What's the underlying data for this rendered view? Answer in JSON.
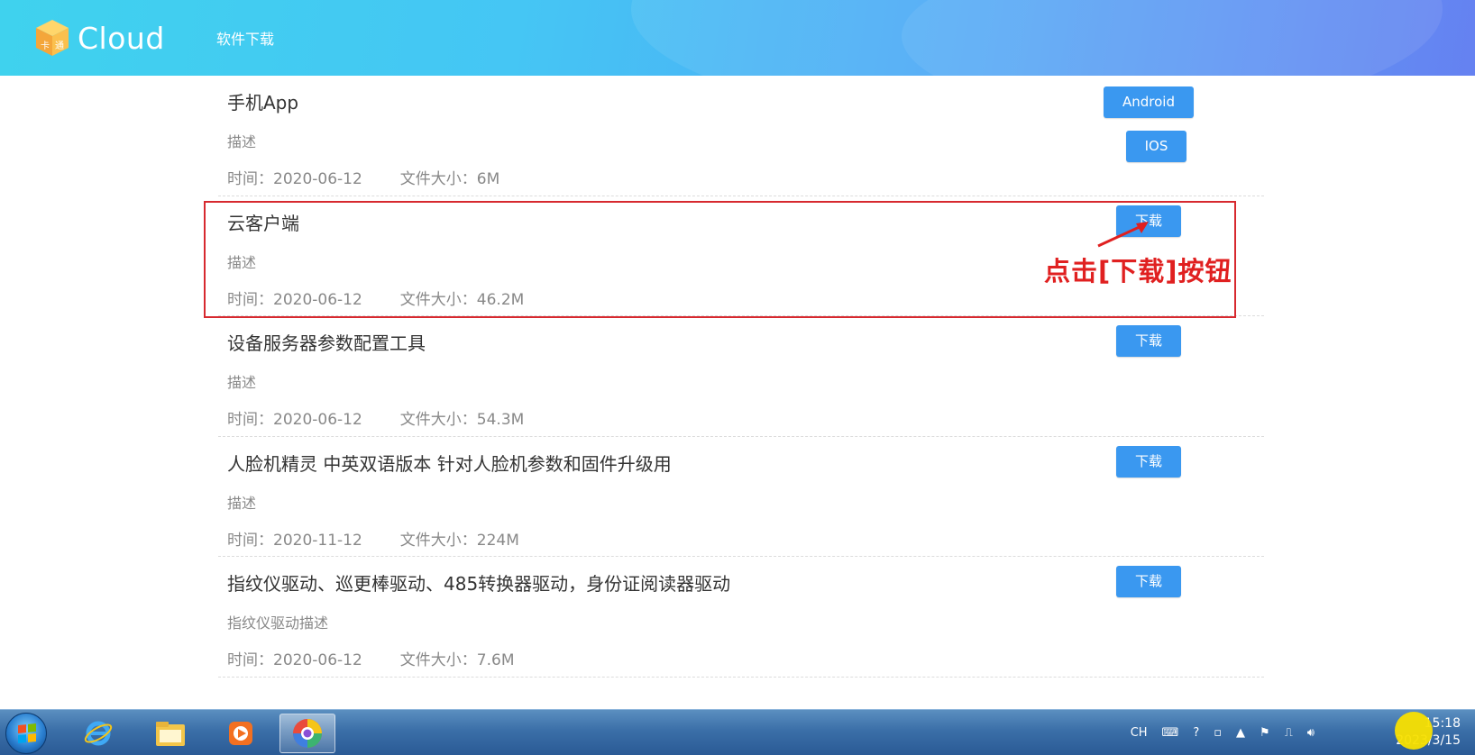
{
  "header": {
    "logo_text": "Cloud",
    "nav_title": "软件下载"
  },
  "items": [
    {
      "title": "手机App",
      "desc": "描述",
      "time": "时间：2020-06-12",
      "size": "文件大小：6M",
      "buttons": [
        "Android",
        "IOS"
      ]
    },
    {
      "title": "云客户端",
      "desc": "描述",
      "time": "时间：2020-06-12",
      "size": "文件大小：46.2M",
      "buttons": [
        "下载"
      ]
    },
    {
      "title": "设备服务器参数配置工具",
      "desc": "描述",
      "time": "时间：2020-06-12",
      "size": "文件大小：54.3M",
      "buttons": [
        "下载"
      ]
    },
    {
      "title": "人脸机精灵 中英双语版本 针对人脸机参数和固件升级用",
      "desc": "描述",
      "time": "时间：2020-11-12",
      "size": "文件大小：224M",
      "buttons": [
        "下载"
      ]
    },
    {
      "title": "指纹仪驱动、巡更棒驱动、485转换器驱动，身份证阅读器驱动",
      "desc": "指纹仪驱动描述",
      "time": "时间：2020-06-12",
      "size": "文件大小：7.6M",
      "buttons": [
        "下载"
      ]
    }
  ],
  "annotation": {
    "text": "点击[下载]按钮",
    "color": "#e02020"
  },
  "taskbar": {
    "tray_lang": "CH",
    "clock_time": "15:18",
    "clock_date": "2023/3/15",
    "icons": [
      "windows-start-icon",
      "internet-explorer-icon",
      "file-explorer-icon",
      "media-player-icon",
      "browser-icon"
    ]
  },
  "colors": {
    "button": "#3a98f0",
    "highlight": "#d7292f"
  }
}
